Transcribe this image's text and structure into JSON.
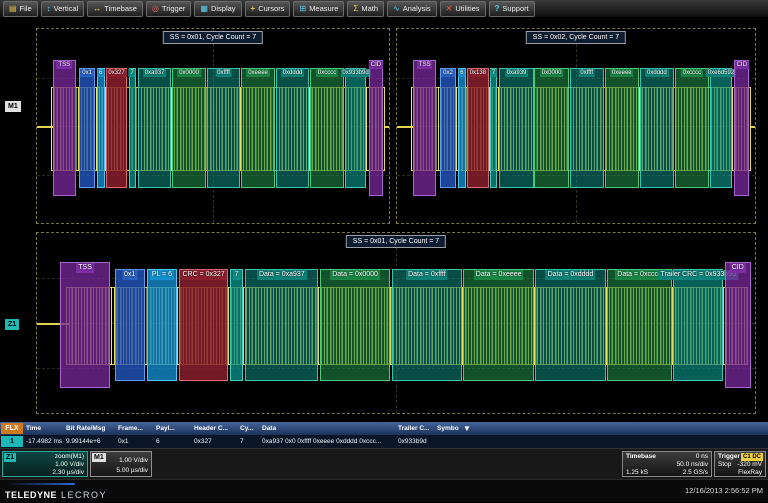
{
  "menu": {
    "items": [
      {
        "label": "File",
        "icon": "▤"
      },
      {
        "label": "Vertical",
        "icon": "↕"
      },
      {
        "label": "Timebase",
        "icon": "↔"
      },
      {
        "label": "Trigger",
        "icon": "◎"
      },
      {
        "label": "Display",
        "icon": "▦"
      },
      {
        "label": "Cursors",
        "icon": "+"
      },
      {
        "label": "Measure",
        "icon": "⊞"
      },
      {
        "label": "Math",
        "icon": "Σ"
      },
      {
        "label": "Analysis",
        "icon": "∿"
      },
      {
        "label": "Utilities",
        "icon": "✕"
      },
      {
        "label": "Support",
        "icon": "?"
      }
    ]
  },
  "panels": {
    "tl": {
      "channel": "M1",
      "banner": "SS = 0x01, Cycle Count = 7",
      "boxes": [
        {
          "label": "TSS"
        },
        {
          "label": "0x1"
        },
        {
          "label": "6"
        },
        {
          "label": "0x327"
        },
        {
          "label": "7"
        },
        {
          "label": "0xa937"
        },
        {
          "label": "0x0000"
        },
        {
          "label": "0xffff"
        },
        {
          "label": "0xeeee"
        },
        {
          "label": "0xdddd"
        },
        {
          "label": "0xcccc"
        },
        {
          "label": "0x933b9d"
        },
        {
          "label": "CID"
        }
      ]
    },
    "tr": {
      "banner": "SS = 0x02, Cycle Count = 7",
      "boxes": [
        {
          "label": "TSS"
        },
        {
          "label": "0x2"
        },
        {
          "label": "6"
        },
        {
          "label": "0x138"
        },
        {
          "label": "7"
        },
        {
          "label": "0xa939"
        },
        {
          "label": "0x0000"
        },
        {
          "label": "0xffff"
        },
        {
          "label": "0xeeee"
        },
        {
          "label": "0xdddd"
        },
        {
          "label": "0xcccc"
        },
        {
          "label": "0xe6d592"
        },
        {
          "label": "CID"
        }
      ]
    },
    "bt": {
      "channel": "Z1",
      "banner": "SS = 0x01, Cycle Count = 7",
      "boxes": [
        {
          "label": "TSS"
        },
        {
          "label": "0x1"
        },
        {
          "label": "PL = 6"
        },
        {
          "label": "CRC = 0x327"
        },
        {
          "label": "7"
        },
        {
          "label": "Data = 0xa937"
        },
        {
          "label": "Data = 0x0000"
        },
        {
          "label": "Data = 0xffff"
        },
        {
          "label": "Data = 0xeeee"
        },
        {
          "label": "Data = 0xdddd"
        },
        {
          "label": "Data = 0xcccc"
        },
        {
          "label": "Trailer CRC = 0x933b9d"
        },
        {
          "label": "CID"
        }
      ]
    }
  },
  "decode_table": {
    "source_label": "FLX",
    "collapse_icon": "▼",
    "headers": {
      "time": "Time",
      "bitrate": "Bit Rate/Msg",
      "frame": "Frame...",
      "payl": "Payl...",
      "hcrc": "Header C...",
      "cy": "Cy...",
      "data": "Data",
      "tcrc": "Trailer C...",
      "symbol": "Symbol"
    },
    "row": {
      "idx": "1",
      "time": "-17.4982 ms",
      "bitrate": "9.99144e+6",
      "frame": "0x1",
      "payl": "6",
      "hcrc": "0x327",
      "cy": "7",
      "data": "0xa937 0x0 0xffff 0xeeee 0xdddd 0xccc...",
      "tcrc": "0x933b9d",
      "symbol": ""
    }
  },
  "status": {
    "z1": {
      "tag": "Z1",
      "desc": "zoom(M1)",
      "vdiv": "1.00 V/div",
      "tdiv": "2.30 µs/div"
    },
    "m1": {
      "tag": "M1",
      "vdiv": "1.00 V/div",
      "tdiv": "5.00 µs/div"
    },
    "timebase": {
      "title": "Timebase",
      "pos": "0 ns",
      "tdiv": "50.0 ns/div",
      "samples": "1.25 kS",
      "rate": "2.5 GS/s"
    },
    "trigger": {
      "title": "Trigger",
      "source": "C1 DC",
      "mode": "Stop",
      "level": "-320 mV",
      "proto": "FlexRay"
    }
  },
  "footer": {
    "brand1": "TELEDYNE",
    "brand2": "LECROY",
    "datetime": "12/16/2013 2:56:52 PM"
  },
  "colors": {
    "trace": "#f2e04e",
    "decode_tss_cid": "#7d2fa6",
    "decode_id": "#2a62c4",
    "decode_length": "#1490ce",
    "decode_crc": "#8c1e2e",
    "decode_data": "#0f8276",
    "decode_data_alt": "#1b8747",
    "z1_accent": "#22b8b0",
    "flx_badge": "#cf7a1e",
    "table_header": "#2c4c80"
  }
}
